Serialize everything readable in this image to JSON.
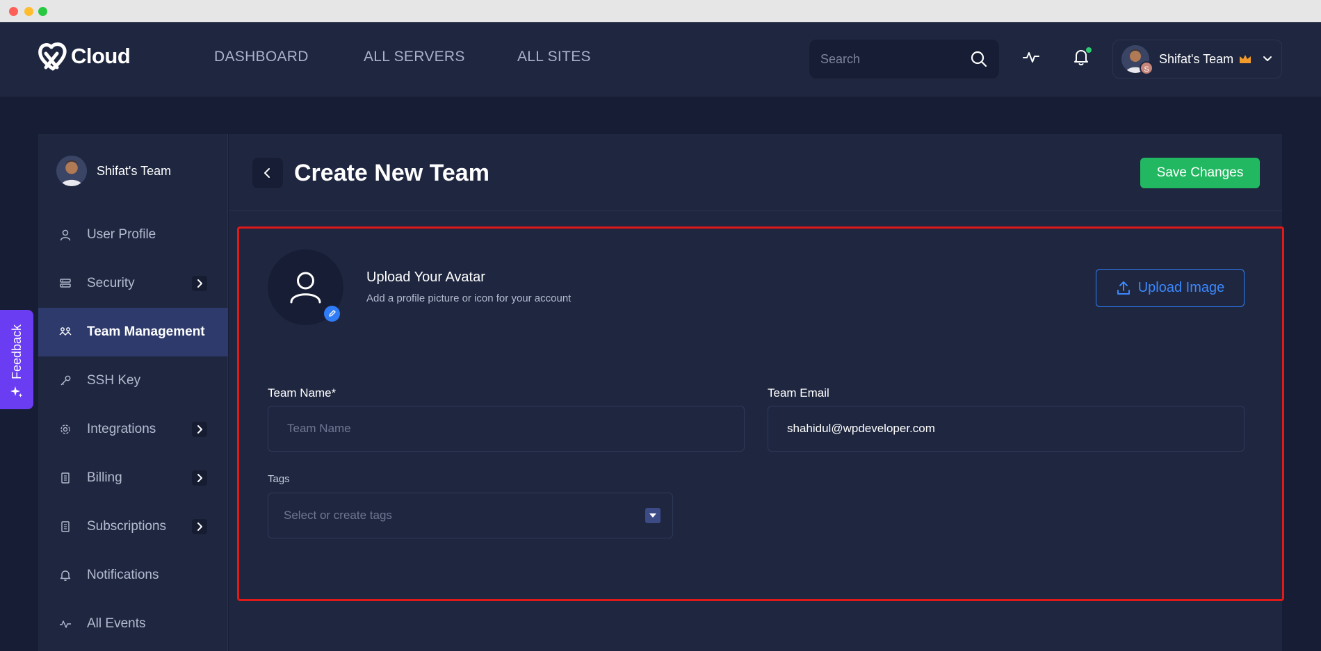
{
  "window": {
    "controls": [
      "close",
      "minimize",
      "maximize"
    ]
  },
  "header": {
    "logo_text": "Cloud",
    "nav": [
      "DASHBOARD",
      "ALL SERVERS",
      "ALL SITES"
    ],
    "search_placeholder": "Search",
    "team_name": "Shifat's Team",
    "avatar_badge": "S"
  },
  "sidebar": {
    "team_name": "Shifat's Team",
    "items": [
      {
        "label": "User Profile",
        "icon": "user-icon"
      },
      {
        "label": "Security",
        "icon": "security-icon",
        "expandable": true
      },
      {
        "label": "Team Management",
        "icon": "team-icon",
        "active": true
      },
      {
        "label": "SSH Key",
        "icon": "key-icon"
      },
      {
        "label": "Integrations",
        "icon": "gear-icon",
        "expandable": true
      },
      {
        "label": "Billing",
        "icon": "billing-icon",
        "expandable": true
      },
      {
        "label": "Subscriptions",
        "icon": "subscriptions-icon",
        "expandable": true
      },
      {
        "label": "Notifications",
        "icon": "bell-icon"
      },
      {
        "label": "All Events",
        "icon": "activity-icon"
      }
    ]
  },
  "main": {
    "title": "Create New Team",
    "save_label": "Save Changes",
    "avatar": {
      "title": "Upload Your Avatar",
      "subtitle": "Add a profile picture or icon for your account",
      "upload_label": "Upload Image"
    },
    "form": {
      "team_name_label": "Team Name*",
      "team_name_placeholder": "Team Name",
      "team_email_label": "Team Email",
      "team_email_value": "shahidul@wpdeveloper.com",
      "tags_label": "Tags",
      "tags_placeholder": "Select or create tags"
    }
  },
  "feedback_label": "Feedback",
  "colors": {
    "background": "#171d34",
    "panel": "#1f2740",
    "accent_green": "#22b861",
    "accent_blue": "#2f7cf6",
    "active_item": "#2d3a6b",
    "highlight": "#e01919",
    "feedback": "#6a3cf2"
  }
}
